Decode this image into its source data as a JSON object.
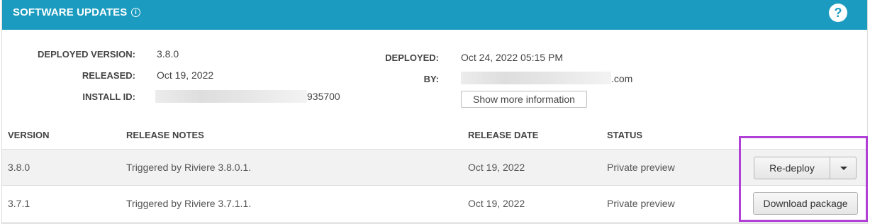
{
  "header": {
    "title": "SOFTWARE UPDATES",
    "info_icon": "info-icon",
    "help_icon": "help-icon",
    "help_glyph": "?",
    "bg_color": "#1b9bbf"
  },
  "details": {
    "deployed_version_label": "DEPLOYED VERSION:",
    "deployed_version": "3.8.0",
    "released_label": "RELEASED:",
    "released": "Oct 19, 2022",
    "install_id_label": "INSTALL ID:",
    "install_id_suffix": "935700",
    "deployed_label": "DEPLOYED:",
    "deployed": "Oct 24, 2022 05:15 PM",
    "by_label": "BY:",
    "by_suffix": ".com",
    "show_more_label": "Show more information"
  },
  "table": {
    "headers": {
      "version": "VERSION",
      "release_notes": "RELEASE NOTES",
      "release_date": "RELEASE DATE",
      "status": "STATUS"
    },
    "rows": [
      {
        "version": "3.8.0",
        "release_notes": "Triggered by Riviere 3.8.0.1.",
        "release_date": "Oct 19, 2022",
        "status": "Private preview",
        "action_label": "Re-deploy"
      },
      {
        "version": "3.7.1",
        "release_notes": "Triggered by Riviere 3.7.1.1.",
        "release_date": "Oct 19, 2022",
        "status": "Private preview",
        "action_label": "Download package"
      }
    ]
  },
  "highlight_color": "#b040d6"
}
